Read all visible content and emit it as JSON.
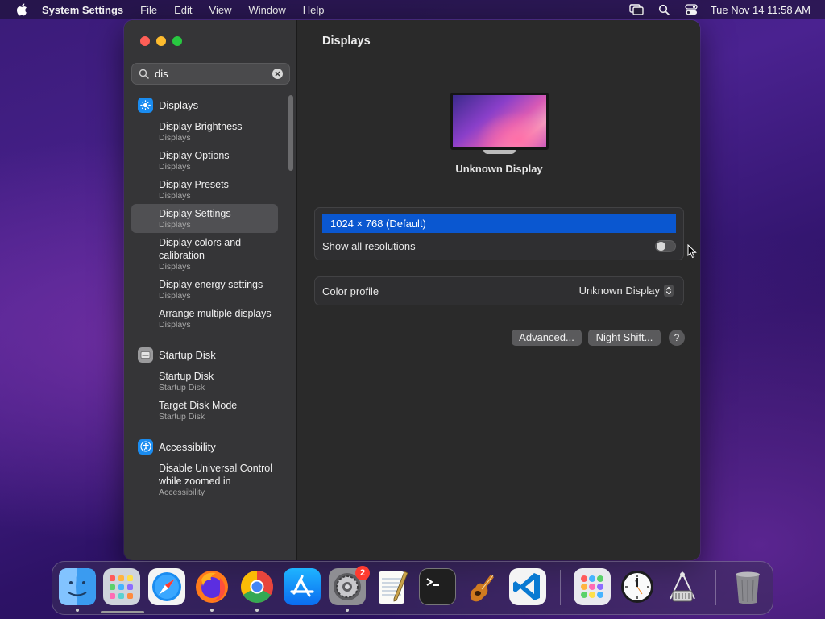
{
  "menubar": {
    "apple_icon": "apple-logo-icon",
    "items": [
      "System Settings",
      "File",
      "Edit",
      "View",
      "Window",
      "Help"
    ],
    "status_icons": [
      "screen-mirroring-icon",
      "spotlight-search-icon",
      "control-center-icon"
    ],
    "clock": "Tue Nov 14  11:58 AM"
  },
  "sidebar": {
    "search": {
      "value": "dis",
      "placeholder": "Search"
    },
    "groups": [
      {
        "label": "Displays",
        "icon": "displays-sun-icon",
        "icon_color": "#1a8cf0",
        "results": [
          {
            "title": "Display Brightness",
            "sub": "Displays"
          },
          {
            "title": "Display Options",
            "sub": "Displays"
          },
          {
            "title": "Display Presets",
            "sub": "Displays"
          },
          {
            "title": "Display Settings",
            "sub": "Displays",
            "selected": true
          },
          {
            "title": "Display colors and calibration",
            "sub": "Displays"
          },
          {
            "title": "Display energy settings",
            "sub": "Displays"
          },
          {
            "title": "Arrange multiple displays",
            "sub": "Displays"
          }
        ]
      },
      {
        "label": "Startup Disk",
        "icon": "startup-disk-icon",
        "icon_color": "#9a9a9c",
        "results": [
          {
            "title": "Startup Disk",
            "sub": "Startup Disk"
          },
          {
            "title": "Target Disk Mode",
            "sub": "Startup Disk"
          }
        ]
      },
      {
        "label": "Accessibility",
        "icon": "accessibility-icon",
        "icon_color": "#1a8cf0",
        "results": [
          {
            "title": "Disable Universal Control while zoomed in",
            "sub": "Accessibility"
          }
        ]
      }
    ]
  },
  "main": {
    "title": "Displays",
    "display_name": "Unknown Display",
    "resolution_selected": "1024 × 768 (Default)",
    "show_all_label": "Show all resolutions",
    "show_all_enabled": false,
    "color_profile_label": "Color profile",
    "color_profile_value": "Unknown Display",
    "advanced_button": "Advanced...",
    "night_shift_button": "Night Shift...",
    "help_button": "?"
  },
  "dock": {
    "apps": [
      {
        "name": "Finder",
        "icon": "finder-icon",
        "running": true
      },
      {
        "name": "Launchpad",
        "icon": "launchpad-icon",
        "running": false
      },
      {
        "name": "Safari",
        "icon": "safari-icon",
        "running": false
      },
      {
        "name": "Firefox",
        "icon": "firefox-icon",
        "running": true
      },
      {
        "name": "Chrome",
        "icon": "chrome-icon",
        "running": true
      },
      {
        "name": "App Store",
        "icon": "app-store-icon",
        "running": false
      },
      {
        "name": "System Settings",
        "icon": "system-settings-icon",
        "running": true,
        "badge": "2"
      },
      {
        "name": "TextEdit",
        "icon": "textedit-icon",
        "running": false
      },
      {
        "name": "Terminal",
        "icon": "terminal-icon",
        "running": false
      },
      {
        "name": "GarageBand",
        "icon": "garageband-icon",
        "running": false
      },
      {
        "name": "VS Code",
        "icon": "vscode-icon",
        "running": false
      },
      {
        "name": "App Folder",
        "icon": "app-folder-icon",
        "running": false
      },
      {
        "name": "Clock",
        "icon": "clock-icon",
        "running": false
      },
      {
        "name": "Archive Utility",
        "icon": "archive-utility-icon",
        "running": false
      },
      {
        "name": "Trash",
        "icon": "trash-icon",
        "running": false
      }
    ]
  }
}
